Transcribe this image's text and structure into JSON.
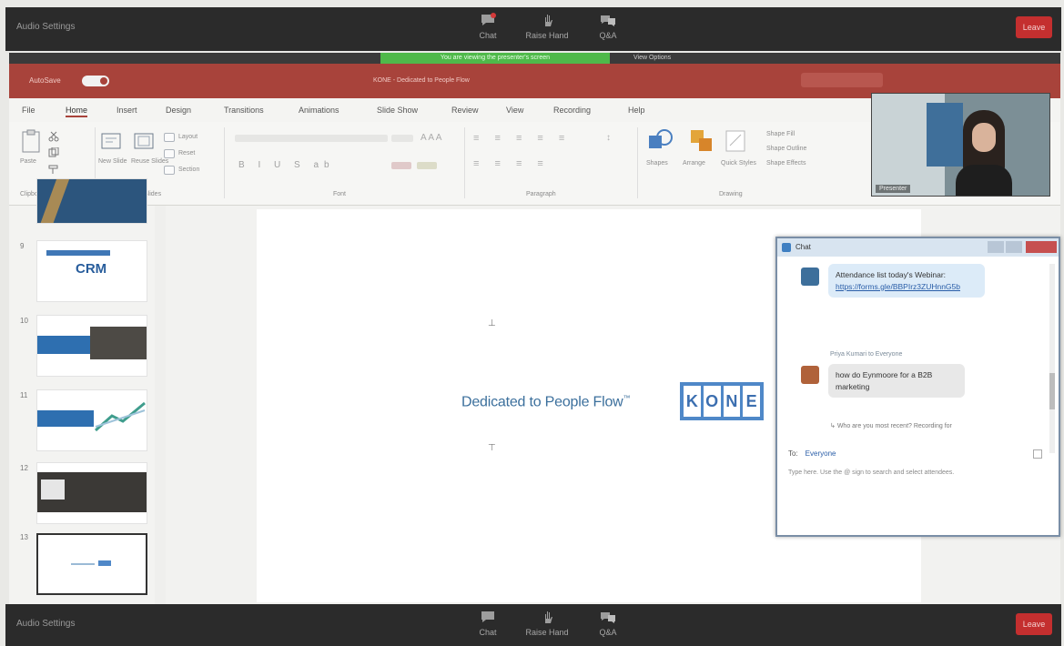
{
  "zoom": {
    "audio_label": "Audio Settings",
    "buttons": [
      {
        "label": "Chat",
        "icon": "chat-icon"
      },
      {
        "label": "Raise Hand",
        "icon": "raise-hand-icon"
      },
      {
        "label": "Q&A",
        "icon": "qa-icon"
      }
    ],
    "leave_label": "Leave",
    "sharing_text": "You are viewing the presenter's screen",
    "view_options": "View Options"
  },
  "ppt": {
    "autosave_label": "AutoSave",
    "toggle_state": "On",
    "doc_title": "KONE - Dedicated to People Flow",
    "tabs": [
      "File",
      "Home",
      "Insert",
      "Design",
      "Transitions",
      "Animations",
      "Slide Show",
      "Review",
      "View",
      "Recording",
      "Help"
    ],
    "active_tab": "Home",
    "groups": [
      "Clipboard",
      "Slides",
      "Font",
      "Paragraph",
      "Drawing"
    ],
    "paste_label": "Paste",
    "new_slide_label": "New Slide",
    "reuse_slides_label": "Reuse Slides",
    "layout_label": "Layout",
    "reset_label": "Reset",
    "section_label": "Section",
    "shapes_label": "Shapes",
    "arrange_label": "Arrange",
    "quick_styles_label": "Quick Styles",
    "shape_fill_label": "Shape Fill",
    "shape_outline_label": "Shape Outline",
    "shape_effects_label": "Shape Effects"
  },
  "thumbnails": [
    {
      "num": "",
      "kind": "partial"
    },
    {
      "num": "9",
      "kind": "crm",
      "text": "CRM"
    },
    {
      "num": "10",
      "kind": "photo-blue"
    },
    {
      "num": "11",
      "kind": "graph-blue"
    },
    {
      "num": "12",
      "kind": "photo-dark"
    },
    {
      "num": "13",
      "kind": "selected-blank"
    }
  ],
  "slide": {
    "tagline": "Dedicated to People Flow",
    "tagline_tm": "™",
    "logo_letters": [
      "K",
      "O",
      "N",
      "E"
    ]
  },
  "video": {
    "participant_name": "Presenter"
  },
  "chat": {
    "title": "Chat",
    "messages": [
      {
        "text": "Attendance list today's Webinar:",
        "link": "https://forms.gle/BBPIrz3ZUHnnG5b"
      },
      {
        "sender": "Priya Kumari to Everyone",
        "text": "how do Eynmoore for a B2B marketing"
      }
    ],
    "reply_hint": "Who are you most recent? Recording for",
    "to_label": "To:",
    "to_value": "Everyone",
    "input_placeholder": "Type here. Use the @ sign to search and select attendees."
  },
  "colors": {
    "zoom_bar": "#2b2b2b",
    "ppt_accent": "#a8433b",
    "leave_red": "#c42f2f",
    "share_green": "#4fb94a",
    "kone_blue": "#4f88c8",
    "tagline_blue": "#3b6f9c"
  }
}
